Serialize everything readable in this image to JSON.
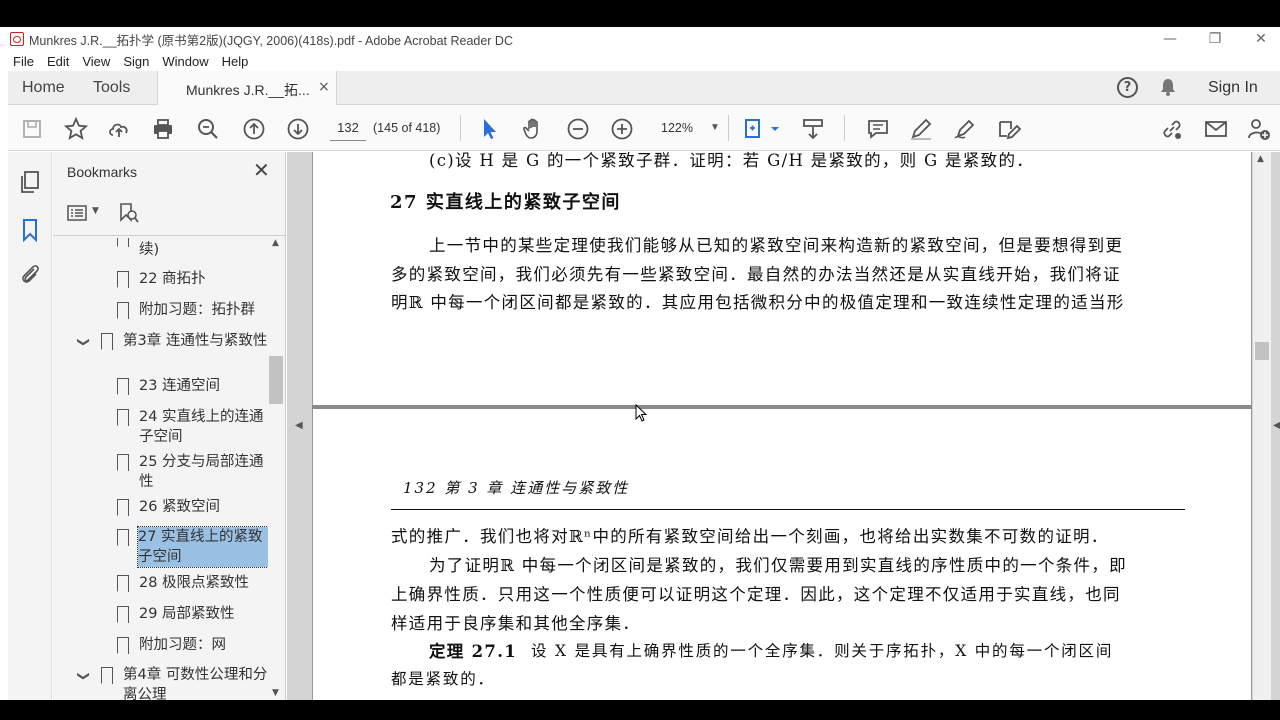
{
  "window": {
    "title": "Munkres J.R.__拓扑学 (原书第2版)(JQGY, 2006)(418s).pdf - Adobe Acrobat Reader DC",
    "controls": [
      "—",
      "❐",
      "✕"
    ]
  },
  "menu": [
    "File",
    "Edit",
    "View",
    "Sign",
    "Window",
    "Help"
  ],
  "tabs": {
    "home": "Home",
    "tools": "Tools",
    "document": "Munkres J.R.__拓...",
    "close": "×",
    "help": "?",
    "signin": "Sign In"
  },
  "toolbar": {
    "page_number": "132",
    "page_count": "(145 of 418)",
    "zoom": "122%"
  },
  "bookmarks": {
    "title": "Bookmarks",
    "close": "✕",
    "items": [
      {
        "label": "续)",
        "level": 2
      },
      {
        "label": "22  商拓扑",
        "level": 2
      },
      {
        "label": "附加习题：拓扑群",
        "level": 2
      },
      {
        "label": "第3章  连通性与紧致性",
        "level": 1,
        "expanded": true
      },
      {
        "label": "23  连通空间",
        "level": 2
      },
      {
        "label": "24  实直线上的连通子空间",
        "level": 2
      },
      {
        "label": "25  分支与局部连通性",
        "level": 2
      },
      {
        "label": "26  紧致空间",
        "level": 2
      },
      {
        "label": "27  实直线上的紧致子空间",
        "level": 2,
        "selected": true
      },
      {
        "label": "28  极限点紧致性",
        "level": 2
      },
      {
        "label": "29  局部紧致性",
        "level": 2
      },
      {
        "label": "附加习题：网",
        "level": 2
      },
      {
        "label": "第4章  可数性公理和分离公理",
        "level": 1,
        "expanded": true
      }
    ]
  },
  "document": {
    "page1": {
      "top_line": "(c)设 H 是 G 的一个紧致子群．证明：若 G/H 是紧致的，则 G 是紧致的．",
      "heading": "27    实直线上的紧致子空间",
      "para_lines": [
        "上一节中的某些定理使我们能够从已知的紧致空间来构造新的紧致空间，但是要想得到更",
        "多的紧致空间，我们必须先有一些紧致空间．最自然的办法当然还是从实直线开始，我们将证",
        "明ℝ 中每一个闭区间都是紧致的．其应用包括微积分中的极值定理和一致连续性定理的适当形"
      ]
    },
    "page2": {
      "running_head": "132        第 3 章   连通性与紧致性",
      "lines": [
        "式的推广．我们也将对ℝⁿ中的所有紧致空间给出一个刻画，也将给出实数集不可数的证明．",
        "为了证明ℝ 中每一个闭区间是紧致的，我们仅需要用到实直线的序性质中的一个条件，即",
        "上确界性质．只用这一个性质便可以证明这个定理．因此，这个定理不仅适用于实直线，也同",
        "样适用于良序集和其他全序集．"
      ],
      "theorem_label": "定理 27.1",
      "theorem_line1": "设 X 是具有上确界性质的一个全序集．则关于序拓扑，X 中的每一个闭区间",
      "theorem_line2": "都是紧致的．"
    }
  },
  "colors": {
    "accent_blue": "#2a6fd6",
    "selection": "#9ac0e4",
    "pdf_red": "#c8201c"
  }
}
